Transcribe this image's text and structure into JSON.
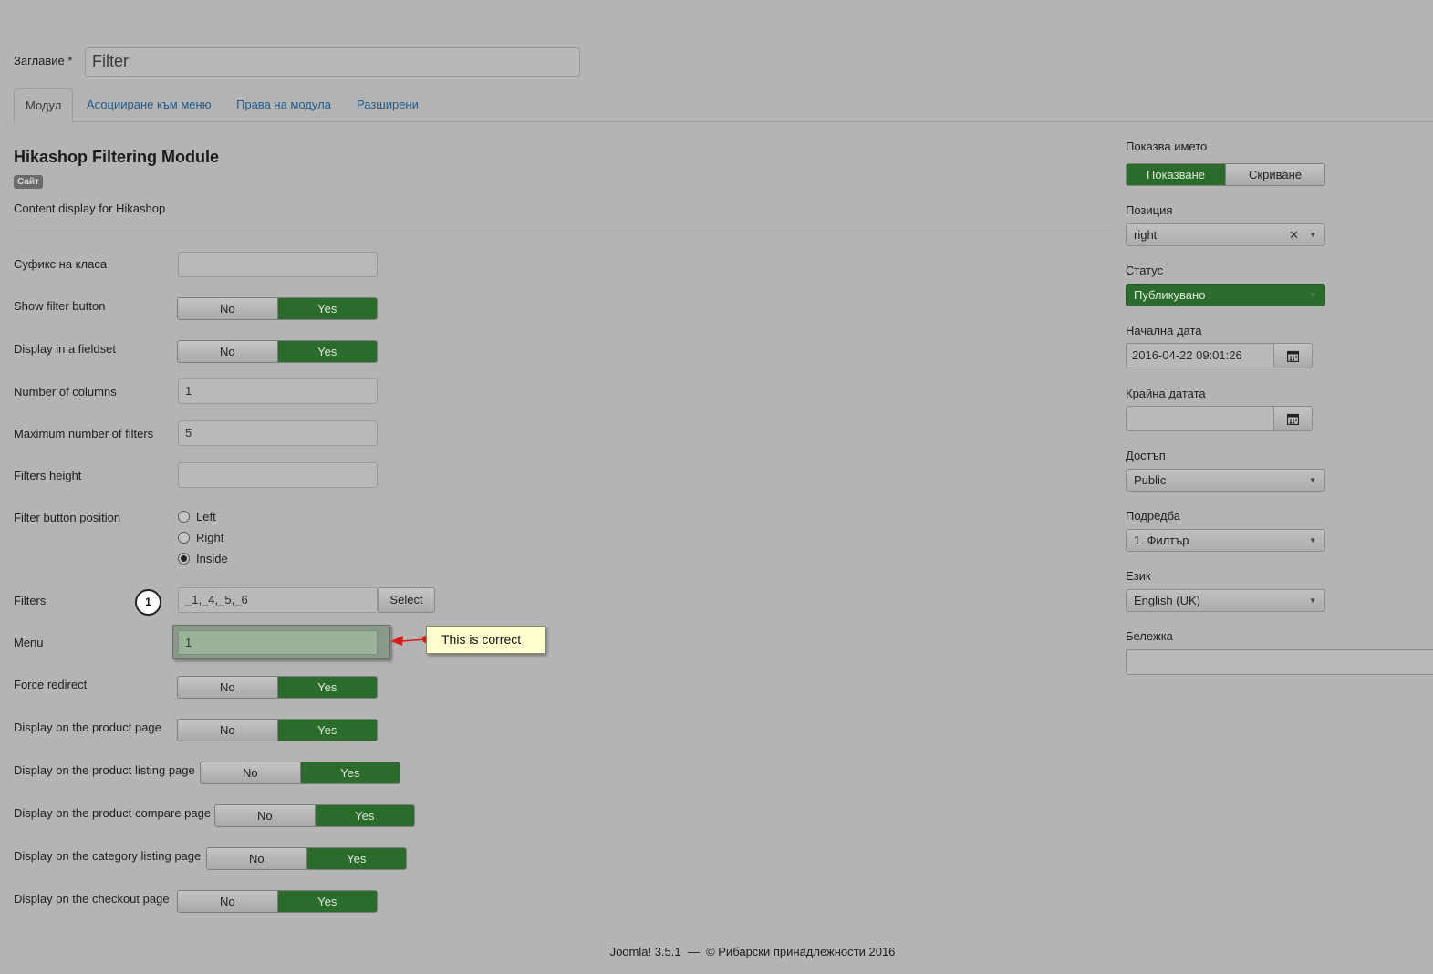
{
  "header": {
    "title_label": "Заглавие *",
    "title_value": "Filter"
  },
  "tabs": [
    {
      "label": "Модул",
      "active": true
    },
    {
      "label": "Асоцииране към меню",
      "active": false
    },
    {
      "label": "Права на модула",
      "active": false
    },
    {
      "label": "Разширени",
      "active": false
    }
  ],
  "module": {
    "title": "Hikashop Filtering Module",
    "badge": "Сайт",
    "description": "Content display for Hikashop"
  },
  "fields": {
    "class_suffix": {
      "label": "Суфикс на класа",
      "value": ""
    },
    "show_filter_button": {
      "label": "Show filter button",
      "no": "No",
      "yes": "Yes",
      "selected": "Yes"
    },
    "display_fieldset": {
      "label": "Display in a fieldset",
      "no": "No",
      "yes": "Yes",
      "selected": "Yes"
    },
    "num_columns": {
      "label": "Number of columns",
      "value": "1"
    },
    "max_filters": {
      "label": "Maximum number of filters",
      "value": "5"
    },
    "filters_height": {
      "label": "Filters height",
      "value": ""
    },
    "filter_button_position": {
      "label": "Filter button position",
      "options": [
        "Left",
        "Right",
        "Inside"
      ],
      "selected": "Inside"
    },
    "filters": {
      "label": "Filters",
      "value": "_1,_4,_5,_6",
      "select_label": "Select",
      "step": "1"
    },
    "menu": {
      "label": "Menu",
      "value": "1",
      "callout": "This is correct"
    },
    "force_redirect": {
      "label": "Force redirect",
      "no": "No",
      "yes": "Yes",
      "selected": "Yes"
    },
    "display_product_page": {
      "label": "Display on the product page",
      "no": "No",
      "yes": "Yes",
      "selected": "Yes"
    },
    "display_product_listing": {
      "label": "Display on the product listing page",
      "no": "No",
      "yes": "Yes",
      "selected": "Yes"
    },
    "display_product_compare": {
      "label": "Display on the product compare page",
      "no": "No",
      "yes": "Yes",
      "selected": "Yes"
    },
    "display_category_listing": {
      "label": "Display on the category listing page",
      "no": "No",
      "yes": "Yes",
      "selected": "Yes"
    },
    "display_checkout": {
      "label": "Display on the checkout page",
      "no": "No",
      "yes": "Yes",
      "selected": "Yes"
    }
  },
  "sidebar": {
    "show_title": {
      "label": "Показва името",
      "on": "Показване",
      "off": "Скриване",
      "selected": "Показване"
    },
    "position": {
      "label": "Позиция",
      "value": "right"
    },
    "status": {
      "label": "Статус",
      "value": "Публикувано"
    },
    "start_date": {
      "label": "Начална дата",
      "value": "2016-04-22 09:01:26"
    },
    "end_date": {
      "label": "Крайна датата",
      "value": ""
    },
    "access": {
      "label": "Достъп",
      "value": "Public"
    },
    "ordering": {
      "label": "Подредба",
      "value": "1. Филтър"
    },
    "language": {
      "label": "Език",
      "value": "English (UK)"
    },
    "note": {
      "label": "Бележка",
      "value": ""
    }
  },
  "footer": {
    "text": "Joomla! 3.5.1  —  © Рибарски принадлежности 2016"
  },
  "colors": {
    "background": "#b4b4b4",
    "toggle_on": "#2b6b2b",
    "link": "#1e5b8a",
    "callout_bg": "#ffffd0"
  }
}
